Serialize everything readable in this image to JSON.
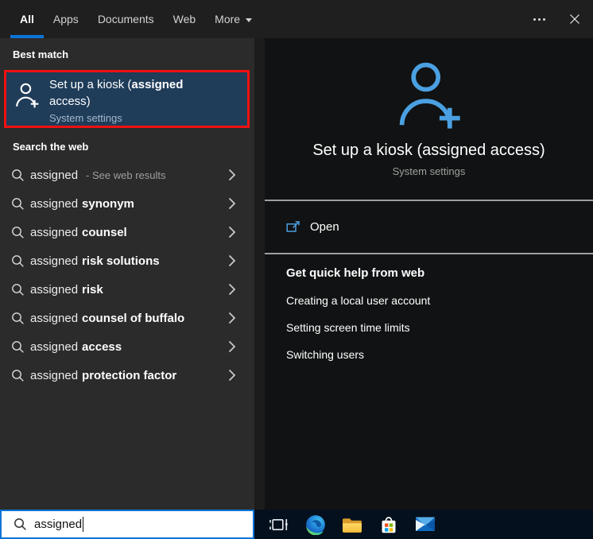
{
  "topbar": {
    "tabs": [
      {
        "label": "All",
        "active": true
      },
      {
        "label": "Apps",
        "active": false
      },
      {
        "label": "Documents",
        "active": false
      },
      {
        "label": "Web",
        "active": false
      },
      {
        "label": "More",
        "active": false,
        "has_dropdown": true
      }
    ],
    "overflow_menu": "more-options",
    "close": "close"
  },
  "best_match": {
    "header": "Best match",
    "title_pre": "Set up a kiosk (",
    "title_match": "assigned",
    "title_post": " access)",
    "subtitle": "System settings",
    "icon": "add-user-icon"
  },
  "web_section": {
    "header": "Search the web",
    "items": [
      {
        "query": "assigned",
        "bold": "",
        "meta": "- See web results"
      },
      {
        "query": "assigned",
        "bold": "synonym"
      },
      {
        "query": "assigned",
        "bold": "counsel"
      },
      {
        "query": "assigned",
        "bold": "risk solutions"
      },
      {
        "query": "assigned",
        "bold": "risk"
      },
      {
        "query": "assigned",
        "bold": "counsel of buffalo"
      },
      {
        "query": "assigned",
        "bold": "access"
      },
      {
        "query": "assigned",
        "bold": "protection factor"
      }
    ]
  },
  "preview": {
    "icon": "add-user-icon",
    "title": "Set up a kiosk (assigned access)",
    "subtitle": "System settings",
    "open_label": "Open",
    "open_icon": "open-external-icon",
    "help_header": "Get quick help from web",
    "help_links": [
      "Creating a local user account",
      "Setting screen time limits",
      "Switching users"
    ]
  },
  "search_box": {
    "value": "assigned",
    "icon": "search-icon"
  },
  "taskbar": {
    "icons": [
      "task-view",
      "edge-browser",
      "file-explorer",
      "microsoft-store",
      "mail"
    ]
  },
  "colors": {
    "accent_blue": "#0c74d6",
    "icon_blue": "#4ba0e1",
    "best_match_bg": "#1f3c59",
    "annotation_red": "#ee1111",
    "left_panel_bg": "#2b2b2b",
    "right_panel_bg": "#111213",
    "taskbar_bg": "#04101d"
  }
}
